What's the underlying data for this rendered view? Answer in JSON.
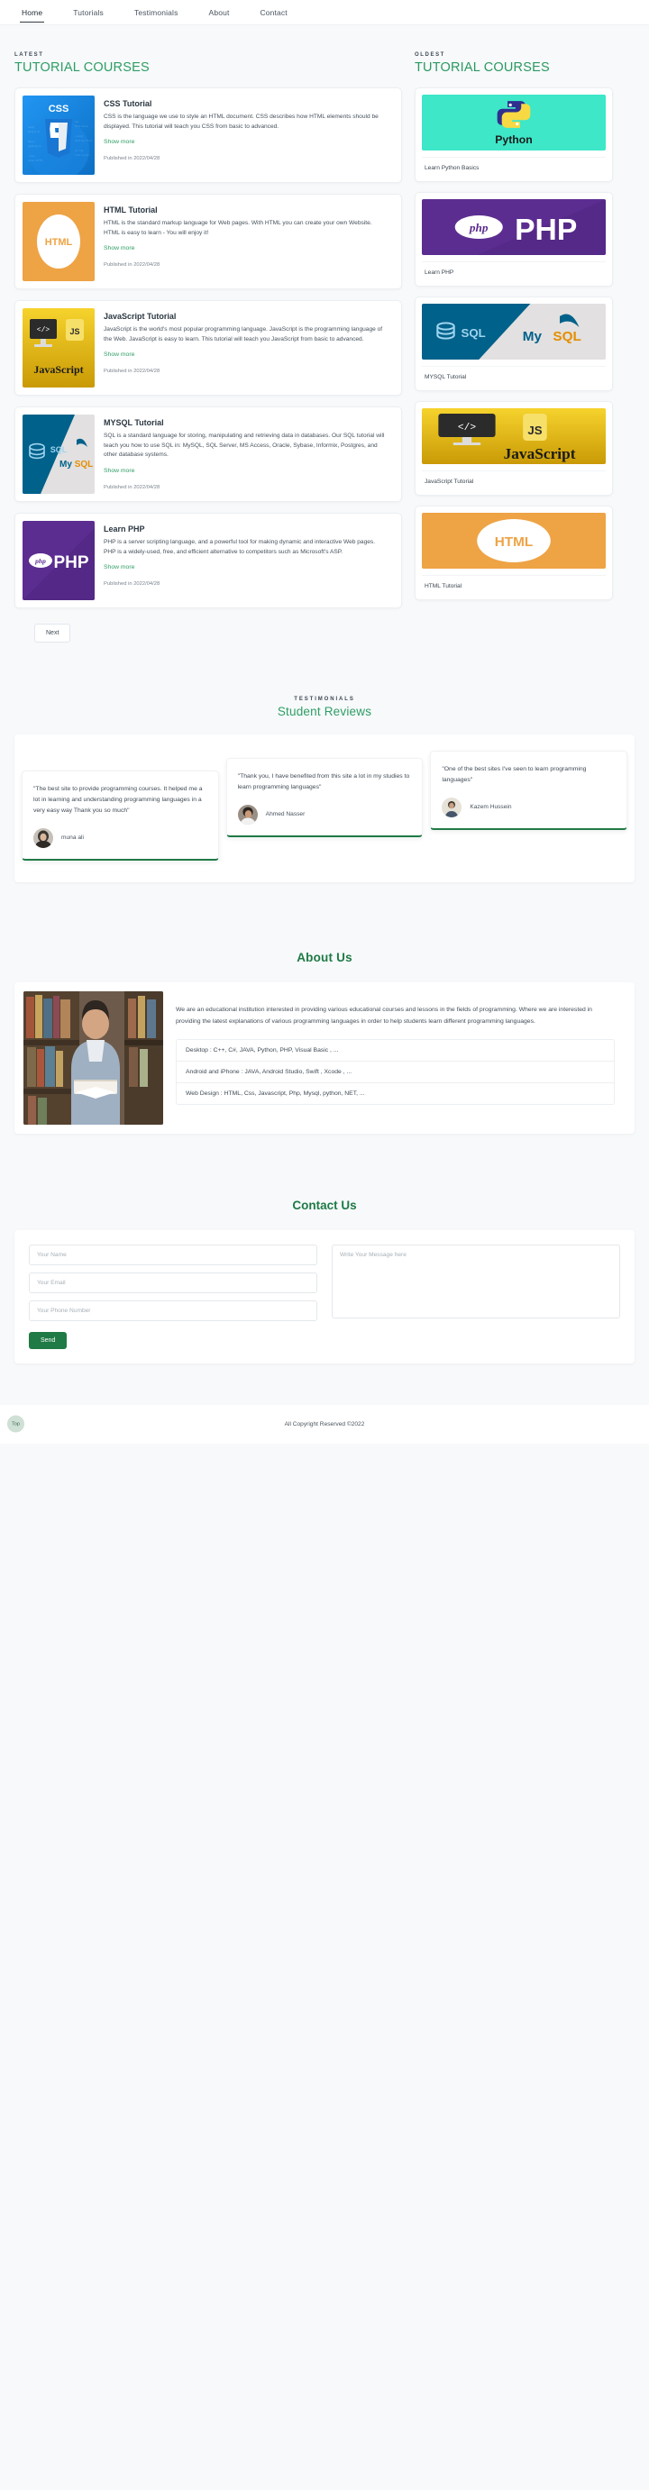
{
  "nav": {
    "items": [
      {
        "label": "Home",
        "active": true
      },
      {
        "label": "Tutorials",
        "active": false
      },
      {
        "label": "Testimonials",
        "active": false
      },
      {
        "label": "About",
        "active": false
      },
      {
        "label": "Contact",
        "active": false
      }
    ]
  },
  "latest": {
    "eyebrow": "LATEST",
    "title": "TUTORIAL COURSES",
    "show_more_label": "Show more",
    "next_label": "Next",
    "courses": [
      {
        "title": "CSS Tutorial",
        "desc": "CSS is the language we use to style an HTML document. CSS describes how HTML elements should be displayed. This tutorial will teach you CSS from basic to advanced.",
        "published": "Published in 2022/04/28",
        "thumb": "css3-logo"
      },
      {
        "title": "HTML Tutorial",
        "desc": "HTML is the standard markup language for Web pages. With HTML you can create your own Website. HTML is easy to learn - You will enjoy it!",
        "published": "Published in 2022/04/28",
        "thumb": "html-logo"
      },
      {
        "title": "JavaScript Tutorial",
        "desc": "JavaScript is the world's most popular programming language. JavaScript is the programming language of the Web. JavaScript is easy to learn. This tutorial will teach you JavaScript from basic to advanced.",
        "published": "Published in 2022/04/28",
        "thumb": "javascript-logo"
      },
      {
        "title": "MYSQL Tutorial",
        "desc": "SQL is a standard language for storing, manipulating and retrieving data in databases. Our SQL tutorial will teach you how to use SQL in: MySQL, SQL Server, MS Access, Oracle, Sybase, Informix, Postgres, and other database systems.",
        "published": "Published in 2022/04/28",
        "thumb": "mysql-logo"
      },
      {
        "title": "Learn PHP",
        "desc": "PHP is a server scripting language, and a powerful tool for making dynamic and interactive Web pages. PHP is a widely-used, free, and efficient alternative to competitors such as Microsoft's ASP.",
        "published": "Published in 2022/04/28",
        "thumb": "php-logo"
      }
    ]
  },
  "oldest": {
    "eyebrow": "OLDEST",
    "title": "TUTORIAL COURSES",
    "courses": [
      {
        "label": "Learn Python Basics",
        "thumb": "python-logo"
      },
      {
        "label": "Learn PHP",
        "thumb": "php-logo"
      },
      {
        "label": "MYSQL Tutorial",
        "thumb": "mysql-logo"
      },
      {
        "label": "JavaScript Tutorial",
        "thumb": "javascript-logo"
      },
      {
        "label": "HTML Tutorial",
        "thumb": "html-logo"
      }
    ]
  },
  "testimonials": {
    "eyebrow": "TESTIMONIALS",
    "title": "Student Reviews",
    "items": [
      {
        "quote": "\"The best site to provide programming courses. It helped me a lot in learning and understanding programming languages in a very easy way Thank you so much\"",
        "name": "muna ali"
      },
      {
        "quote": "\"Thank you, I have benefited from this site a lot in my studies to learn programming languages\"",
        "name": "Ahmed Nasser"
      },
      {
        "quote": "\"One of the best sites I've seen to learn programming languages\"",
        "name": "Kazem Hussein"
      }
    ]
  },
  "about": {
    "title": "About Us",
    "text": "We are an educational institution interested in providing various educational courses and lessons in the fields of programming. Where we are interested in providing the latest explanations of various programming languages in order to help students learn different programming languages.",
    "list": [
      "Desktop : C++, C#, JAVA, Python, PHP, Visual Basic , ...",
      "Android and iPhone : JAVA, Android Studio, Swift , Xcode , ...",
      "Web Design : HTML, Css, Javascript, Php, Mysql, python, NET, ..."
    ]
  },
  "contact": {
    "title": "Contact Us",
    "name_placeholder": "Your Name",
    "email_placeholder": "Your Email",
    "phone_placeholder": "Your Phone Number",
    "message_placeholder": "Write Your Message here",
    "name_value": "",
    "email_value": "",
    "phone_value": "",
    "message_value": "",
    "send_label": "Send"
  },
  "footer": {
    "copyright": "All Copyright Reserved ©2022",
    "top_label": "Top"
  },
  "colors": {
    "accent_green": "#1f7a45",
    "title_green": "#2e9e64",
    "page_bg": "#f7f9fb",
    "card_bg": "#ffffff"
  }
}
